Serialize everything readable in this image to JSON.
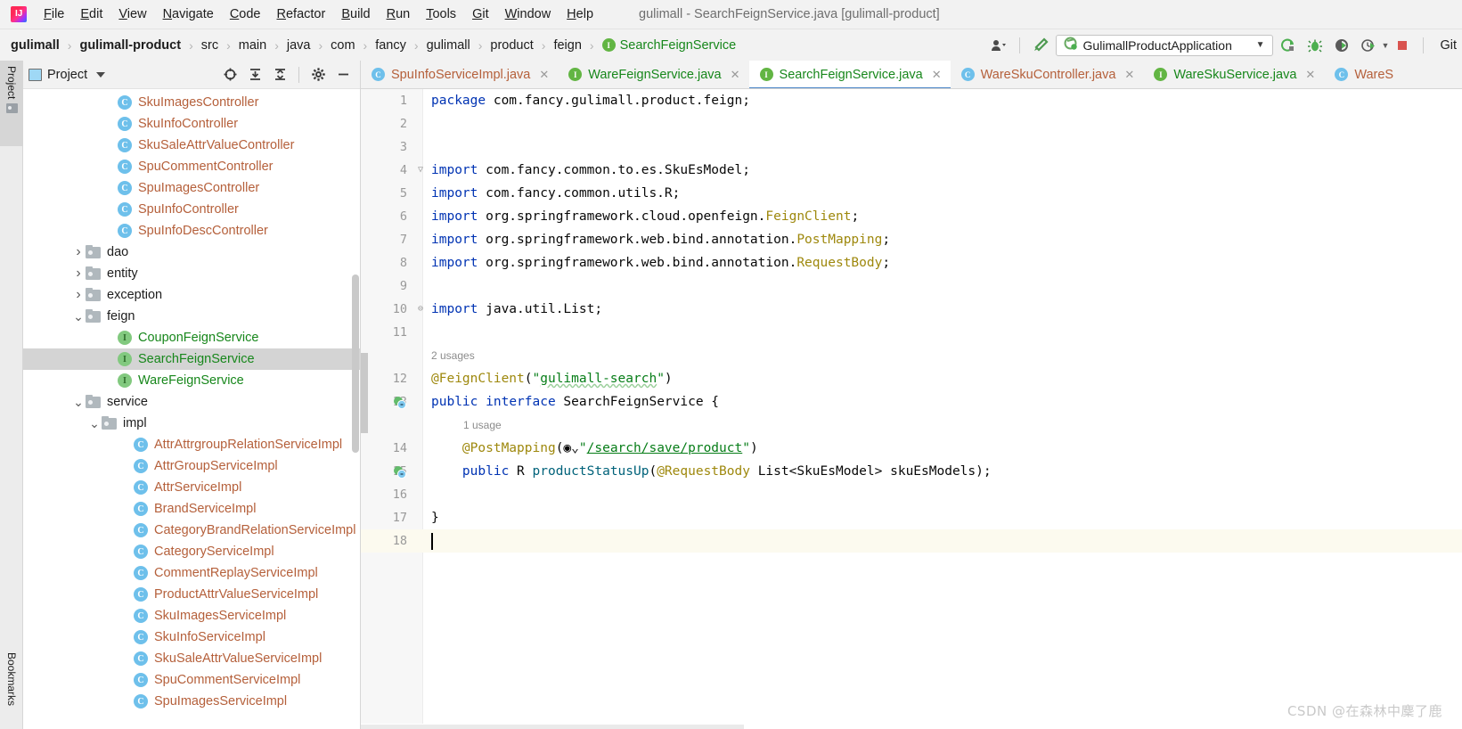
{
  "window": {
    "title": "gulimall - SearchFeignService.java [gulimall-product]",
    "logo_text": "IJ"
  },
  "menubar": {
    "items": [
      {
        "label": "File"
      },
      {
        "label": "Edit"
      },
      {
        "label": "View"
      },
      {
        "label": "Navigate"
      },
      {
        "label": "Code"
      },
      {
        "label": "Refactor"
      },
      {
        "label": "Build"
      },
      {
        "label": "Run"
      },
      {
        "label": "Tools"
      },
      {
        "label": "Git"
      },
      {
        "label": "Window"
      },
      {
        "label": "Help"
      }
    ]
  },
  "breadcrumb": {
    "items": [
      {
        "label": "gulimall",
        "style": "bold"
      },
      {
        "label": "gulimall-product",
        "style": "bold"
      },
      {
        "label": "src",
        "style": "plain"
      },
      {
        "label": "main",
        "style": "plain"
      },
      {
        "label": "java",
        "style": "plain"
      },
      {
        "label": "com",
        "style": "plain"
      },
      {
        "label": "fancy",
        "style": "plain"
      },
      {
        "label": "gulimall",
        "style": "plain"
      },
      {
        "label": "product",
        "style": "plain"
      },
      {
        "label": "feign",
        "style": "plain"
      },
      {
        "label": "SearchFeignService",
        "style": "interface",
        "badge": "I"
      }
    ],
    "separator": "›"
  },
  "navbar_right": {
    "user_icon": "user-avatar-icon",
    "build_icon": "build-hammer-icon",
    "run_config": {
      "label": "GulimallProductApplication",
      "icon": "spring-boot-icon",
      "dropdown": "▼"
    },
    "actions": [
      {
        "name": "run-button",
        "glyph": "run-icon"
      },
      {
        "name": "debug-button",
        "glyph": "debug-bug-icon"
      },
      {
        "name": "run-with-coverage-button",
        "glyph": "coverage-icon"
      },
      {
        "name": "profiler-button",
        "glyph": "profiler-icon"
      },
      {
        "name": "stop-button",
        "glyph": "stop-icon"
      }
    ],
    "git_label": "Git"
  },
  "tool_strip": {
    "project_label": "Project",
    "bookmarks_label": "Bookmarks"
  },
  "project_panel": {
    "title": "Project",
    "dropdown": "▼",
    "actions": [
      {
        "name": "select-opened-file-icon",
        "glyph": "⊕"
      },
      {
        "name": "expand-all-icon",
        "glyph": "⨇"
      },
      {
        "name": "collapse-all-icon",
        "glyph": "⨆"
      },
      {
        "name": "settings-gear-icon",
        "glyph": "⚙"
      },
      {
        "name": "hide-panel-icon",
        "glyph": "−"
      }
    ],
    "tree": [
      {
        "label": "SkuImagesController",
        "kind": "class",
        "indent": 5
      },
      {
        "label": "SkuInfoController",
        "kind": "class",
        "indent": 5
      },
      {
        "label": "SkuSaleAttrValueController",
        "kind": "class",
        "indent": 5
      },
      {
        "label": "SpuCommentController",
        "kind": "class",
        "indent": 5
      },
      {
        "label": "SpuImagesController",
        "kind": "class",
        "indent": 5
      },
      {
        "label": "SpuInfoController",
        "kind": "class",
        "indent": 5
      },
      {
        "label": "SpuInfoDescController",
        "kind": "class",
        "indent": 5
      },
      {
        "label": "dao",
        "kind": "folder",
        "indent": 3,
        "twisty": "collapsed"
      },
      {
        "label": "entity",
        "kind": "folder",
        "indent": 3,
        "twisty": "collapsed"
      },
      {
        "label": "exception",
        "kind": "folder",
        "indent": 3,
        "twisty": "collapsed"
      },
      {
        "label": "feign",
        "kind": "folder",
        "indent": 3,
        "twisty": "expanded"
      },
      {
        "label": "CouponFeignService",
        "kind": "interface",
        "indent": 5
      },
      {
        "label": "SearchFeignService",
        "kind": "interface",
        "indent": 5,
        "selected": true
      },
      {
        "label": "WareFeignService",
        "kind": "interface",
        "indent": 5
      },
      {
        "label": "service",
        "kind": "folder",
        "indent": 3,
        "twisty": "expanded"
      },
      {
        "label": "impl",
        "kind": "folder",
        "indent": 4,
        "twisty": "expanded"
      },
      {
        "label": "AttrAttrgroupRelationServiceImpl",
        "kind": "class",
        "indent": 6
      },
      {
        "label": "AttrGroupServiceImpl",
        "kind": "class",
        "indent": 6
      },
      {
        "label": "AttrServiceImpl",
        "kind": "class",
        "indent": 6
      },
      {
        "label": "BrandServiceImpl",
        "kind": "class",
        "indent": 6
      },
      {
        "label": "CategoryBrandRelationServiceImpl",
        "kind": "class",
        "indent": 6
      },
      {
        "label": "CategoryServiceImpl",
        "kind": "class",
        "indent": 6
      },
      {
        "label": "CommentReplayServiceImpl",
        "kind": "class",
        "indent": 6
      },
      {
        "label": "ProductAttrValueServiceImpl",
        "kind": "class",
        "indent": 6
      },
      {
        "label": "SkuImagesServiceImpl",
        "kind": "class",
        "indent": 6
      },
      {
        "label": "SkuInfoServiceImpl",
        "kind": "class",
        "indent": 6
      },
      {
        "label": "SkuSaleAttrValueServiceImpl",
        "kind": "class",
        "indent": 6
      },
      {
        "label": "SpuCommentServiceImpl",
        "kind": "class",
        "indent": 6
      },
      {
        "label": "SpuImagesServiceImpl",
        "kind": "class",
        "indent": 6
      }
    ]
  },
  "editor": {
    "tabs": [
      {
        "label": "SpuInfoServiceImpl.java",
        "kind": "class",
        "active": false,
        "close": "✕"
      },
      {
        "label": "WareFeignService.java",
        "kind": "interface",
        "active": false,
        "close": "✕"
      },
      {
        "label": "SearchFeignService.java",
        "kind": "interface",
        "active": true,
        "close": "✕"
      },
      {
        "label": "WareSkuController.java",
        "kind": "class",
        "active": false,
        "close": "✕"
      },
      {
        "label": "WareSkuService.java",
        "kind": "interface",
        "active": false,
        "close": "✕"
      },
      {
        "label": "WareS",
        "kind": "class",
        "active": false,
        "close": ""
      }
    ],
    "lines": [
      {
        "n": "1",
        "segments": [
          {
            "t": "package",
            "c": "kw"
          },
          {
            "t": " com.fancy.gulimall.product.feign;",
            "c": "txt"
          }
        ]
      },
      {
        "n": "2",
        "segments": []
      },
      {
        "n": "3",
        "segments": []
      },
      {
        "n": "4",
        "fold": "▽",
        "segments": [
          {
            "t": "import",
            "c": "kw"
          },
          {
            "t": " com.fancy.common.to.es.",
            "c": "txt"
          },
          {
            "t": "SkuEsModel",
            "c": "txt"
          },
          {
            "t": ";",
            "c": "txt"
          }
        ]
      },
      {
        "n": "5",
        "segments": [
          {
            "t": "import",
            "c": "kw"
          },
          {
            "t": " com.fancy.common.utils.R;",
            "c": "txt"
          }
        ]
      },
      {
        "n": "6",
        "segments": [
          {
            "t": "import",
            "c": "kw"
          },
          {
            "t": " org.springframework.cloud.openfeign.",
            "c": "txt"
          },
          {
            "t": "FeignClient",
            "c": "ann"
          },
          {
            "t": ";",
            "c": "txt"
          }
        ]
      },
      {
        "n": "7",
        "segments": [
          {
            "t": "import",
            "c": "kw"
          },
          {
            "t": " org.springframework.web.bind.annotation.",
            "c": "txt"
          },
          {
            "t": "PostMapping",
            "c": "ann"
          },
          {
            "t": ";",
            "c": "txt"
          }
        ]
      },
      {
        "n": "8",
        "segments": [
          {
            "t": "import",
            "c": "kw"
          },
          {
            "t": " org.springframework.web.bind.annotation.",
            "c": "txt"
          },
          {
            "t": "RequestBody",
            "c": "ann"
          },
          {
            "t": ";",
            "c": "txt"
          }
        ]
      },
      {
        "n": "9",
        "segments": []
      },
      {
        "n": "10",
        "fold": "⊖",
        "segments": [
          {
            "t": "import",
            "c": "kw"
          },
          {
            "t": " java.util.List;",
            "c": "txt"
          }
        ]
      },
      {
        "n": "11",
        "segments": []
      },
      {
        "n": "",
        "usage": "2 usages"
      },
      {
        "n": "12",
        "segments": [
          {
            "t": "@FeignClient",
            "c": "ann"
          },
          {
            "t": "(",
            "c": "txt"
          },
          {
            "t": "\"",
            "c": "str"
          },
          {
            "t": "gulimall-search",
            "c": "str squig"
          },
          {
            "t": "\"",
            "c": "str"
          },
          {
            "t": ")",
            "c": "txt"
          }
        ]
      },
      {
        "n": "13",
        "gutter_icon": "implemented-interface-icon",
        "segments": [
          {
            "t": "public",
            "c": "kw"
          },
          {
            "t": " ",
            "c": "txt"
          },
          {
            "t": "interface",
            "c": "kw"
          },
          {
            "t": " SearchFeignService {",
            "c": "txt"
          }
        ]
      },
      {
        "n": "",
        "usage": "1 usage",
        "usage_indent": 4
      },
      {
        "n": "14",
        "segments": [
          {
            "t": "    ",
            "c": "txt"
          },
          {
            "t": "@PostMapping",
            "c": "ann"
          },
          {
            "t": "(",
            "c": "txt"
          },
          {
            "t": "◉⌄",
            "c": "txt"
          },
          {
            "t": "\"",
            "c": "str"
          },
          {
            "t": "/search/save/product",
            "c": "lnk"
          },
          {
            "t": "\"",
            "c": "str"
          },
          {
            "t": ")",
            "c": "txt"
          }
        ]
      },
      {
        "n": "15",
        "gutter_icon": "implementation-icon",
        "segments": [
          {
            "t": "    ",
            "c": "txt"
          },
          {
            "t": "public",
            "c": "kw"
          },
          {
            "t": " R ",
            "c": "txt"
          },
          {
            "t": "productStatusUp",
            "c": "mth"
          },
          {
            "t": "(",
            "c": "txt"
          },
          {
            "t": "@RequestBody",
            "c": "ann"
          },
          {
            "t": " List<SkuEsModel> skuEsModels);",
            "c": "txt"
          }
        ]
      },
      {
        "n": "16",
        "segments": []
      },
      {
        "n": "17",
        "segments": [
          {
            "t": "}",
            "c": "txt"
          }
        ]
      },
      {
        "n": "18",
        "highlight": true,
        "caret": true,
        "segments": []
      }
    ]
  },
  "watermark": "CSDN @在森林中麇了鹿",
  "colors": {
    "accent_blue": "#4a86c8",
    "keyword_blue": "#0033b3",
    "string_green": "#067d17",
    "annotation_yellow": "#9e880d",
    "method_teal": "#00627a",
    "class_icon_blue": "#6ec0eb",
    "interface_icon_green": "#62b543",
    "selection_gray": "#d4d4d4",
    "current_line": "#fcfaef"
  }
}
